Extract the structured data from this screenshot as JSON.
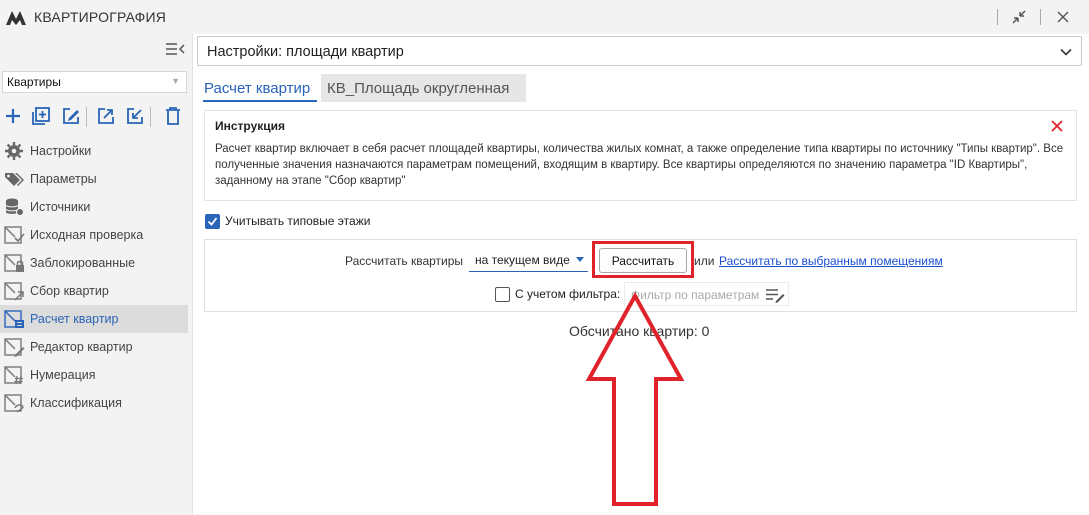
{
  "app": {
    "title": "КВАРТИРОГРАФИЯ"
  },
  "window_controls": {
    "collapse": "collapse-icon",
    "close": "close-icon"
  },
  "sidebar": {
    "combo_value": "Квартиры",
    "toolbar_icons": [
      "plus-icon",
      "add-box-icon",
      "edit-icon",
      "export-icon",
      "import-icon",
      "delete-icon"
    ],
    "items": [
      {
        "label": "Настройки",
        "icon": "gear-icon"
      },
      {
        "label": "Параметры",
        "icon": "tags-icon"
      },
      {
        "label": "Источники",
        "icon": "database-icon"
      },
      {
        "label": "Исходная проверка",
        "icon": "room-check-icon"
      },
      {
        "label": "Заблокированные",
        "icon": "room-lock-icon"
      },
      {
        "label": "Сбор квартир",
        "icon": "room-collect-icon"
      },
      {
        "label": "Расчет квартир",
        "icon": "room-calc-icon",
        "active": true
      },
      {
        "label": "Редактор квартир",
        "icon": "room-edit-icon"
      },
      {
        "label": "Нумерация",
        "icon": "room-number-icon"
      },
      {
        "label": "Классификация",
        "icon": "room-classify-icon"
      }
    ]
  },
  "main": {
    "settings_select": "Настройки: площади квартир",
    "tabs": [
      {
        "label": "Расчет квартир",
        "active": true
      },
      {
        "label": "КВ_Площадь округленная",
        "active": false
      }
    ],
    "instruction": {
      "title": "Инструкция",
      "text": "Расчет квартир включает в себя расчет площадей квартиры, количества жилых комнат, а также определение типа квартиры по источнику \"Типы квартир\". Все полученные значения назначаются параметрам помещений, входящим в квартиру. Все квартиры определяются по значению параметра \"ID Квартиры\", заданному на этапе \"Сбор квартир\""
    },
    "typical_floors": {
      "label": "Учитывать типовые этажи",
      "checked": true
    },
    "calc": {
      "label": "Рассчитать квартиры",
      "mode": "на текущем виде",
      "button": "Рассчитать",
      "or": "или",
      "link": "Рассчитать по выбранным помещениям",
      "filter_label": "С учетом фильтра:",
      "filter_checked": false,
      "filter_placeholder": "Фильтр по параметрам"
    },
    "counter": "Обсчитано квартир: 0"
  },
  "colors": {
    "accent": "#2a64b8",
    "highlight": "#e0232b"
  }
}
